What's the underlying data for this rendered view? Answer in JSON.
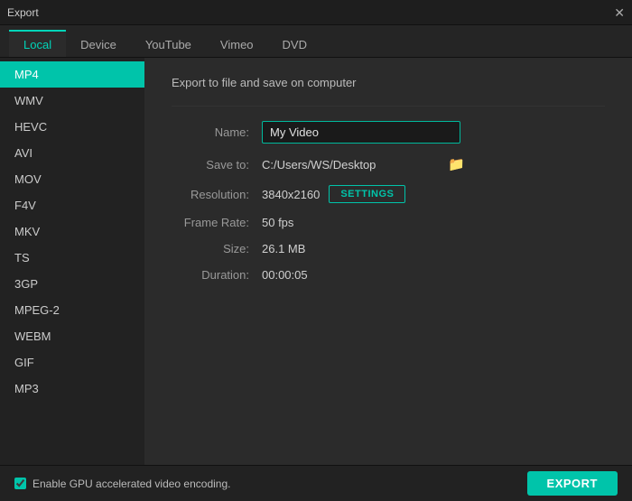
{
  "titleBar": {
    "title": "Export",
    "closeLabel": "✕"
  },
  "tabs": [
    {
      "id": "local",
      "label": "Local",
      "active": true
    },
    {
      "id": "device",
      "label": "Device",
      "active": false
    },
    {
      "id": "youtube",
      "label": "YouTube",
      "active": false
    },
    {
      "id": "vimeo",
      "label": "Vimeo",
      "active": false
    },
    {
      "id": "dvd",
      "label": "DVD",
      "active": false
    }
  ],
  "sidebar": {
    "items": [
      {
        "id": "mp4",
        "label": "MP4",
        "active": true
      },
      {
        "id": "wmv",
        "label": "WMV",
        "active": false
      },
      {
        "id": "hevc",
        "label": "HEVC",
        "active": false
      },
      {
        "id": "avi",
        "label": "AVI",
        "active": false
      },
      {
        "id": "mov",
        "label": "MOV",
        "active": false
      },
      {
        "id": "f4v",
        "label": "F4V",
        "active": false
      },
      {
        "id": "mkv",
        "label": "MKV",
        "active": false
      },
      {
        "id": "ts",
        "label": "TS",
        "active": false
      },
      {
        "id": "3gp",
        "label": "3GP",
        "active": false
      },
      {
        "id": "mpeg2",
        "label": "MPEG-2",
        "active": false
      },
      {
        "id": "webm",
        "label": "WEBM",
        "active": false
      },
      {
        "id": "gif",
        "label": "GIF",
        "active": false
      },
      {
        "id": "mp3",
        "label": "MP3",
        "active": false
      }
    ]
  },
  "content": {
    "sectionTitle": "Export to file and save on computer",
    "nameLabel": "Name:",
    "nameValue": "My Video",
    "saveToLabel": "Save to:",
    "savePath": "C:/Users/WS/Desktop",
    "resolutionLabel": "Resolution:",
    "resolutionValue": "3840x2160",
    "settingsLabel": "SETTINGS",
    "frameRateLabel": "Frame Rate:",
    "frameRateValue": "50 fps",
    "sizeLabel": "Size:",
    "sizeValue": "26.1 MB",
    "durationLabel": "Duration:",
    "durationValue": "00:00:05"
  },
  "bottomBar": {
    "gpuLabel": "Enable GPU accelerated video encoding.",
    "exportLabel": "EXPORT"
  },
  "icons": {
    "folder": "🗁",
    "close": "✕"
  }
}
